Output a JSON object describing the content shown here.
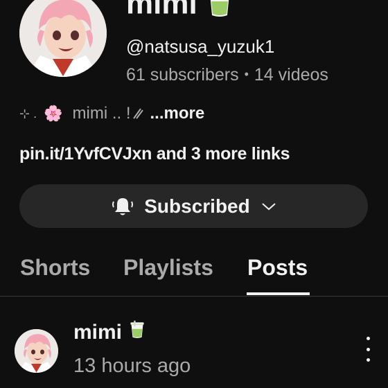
{
  "channel": {
    "name": "mimi",
    "name_icon": "matcha-tea-icon",
    "handle": "@natsusa_yuzuk1",
    "subscribers": "61 subscribers",
    "separator": "•",
    "videos": "14 videos",
    "avatar_icon": "anime-avatar"
  },
  "bio": {
    "prefix": "⊹ .",
    "flower_icon": "🌸",
    "text": "mimi .. ! ",
    "more_label": "...more"
  },
  "links": {
    "primary": "pin.it/1YvfCVJxn",
    "more": " and 3 more links"
  },
  "subscribe_button": {
    "label": "Subscribed",
    "icon": "bell-icon",
    "chevron": "chevron-down-icon"
  },
  "tabs": [
    {
      "label": "Shorts",
      "active": false
    },
    {
      "label": "Playlists",
      "active": false
    },
    {
      "label": "Posts",
      "active": true
    }
  ],
  "post": {
    "author": "mimi",
    "author_icon": "matcha-tea-icon",
    "time": "13 hours ago",
    "menu_icon": "more-vert-icon"
  },
  "colors": {
    "background": "#0f0f0f",
    "text_primary": "#f1f1f1",
    "text_secondary": "#aaaaaa",
    "button_bg": "#272727"
  }
}
